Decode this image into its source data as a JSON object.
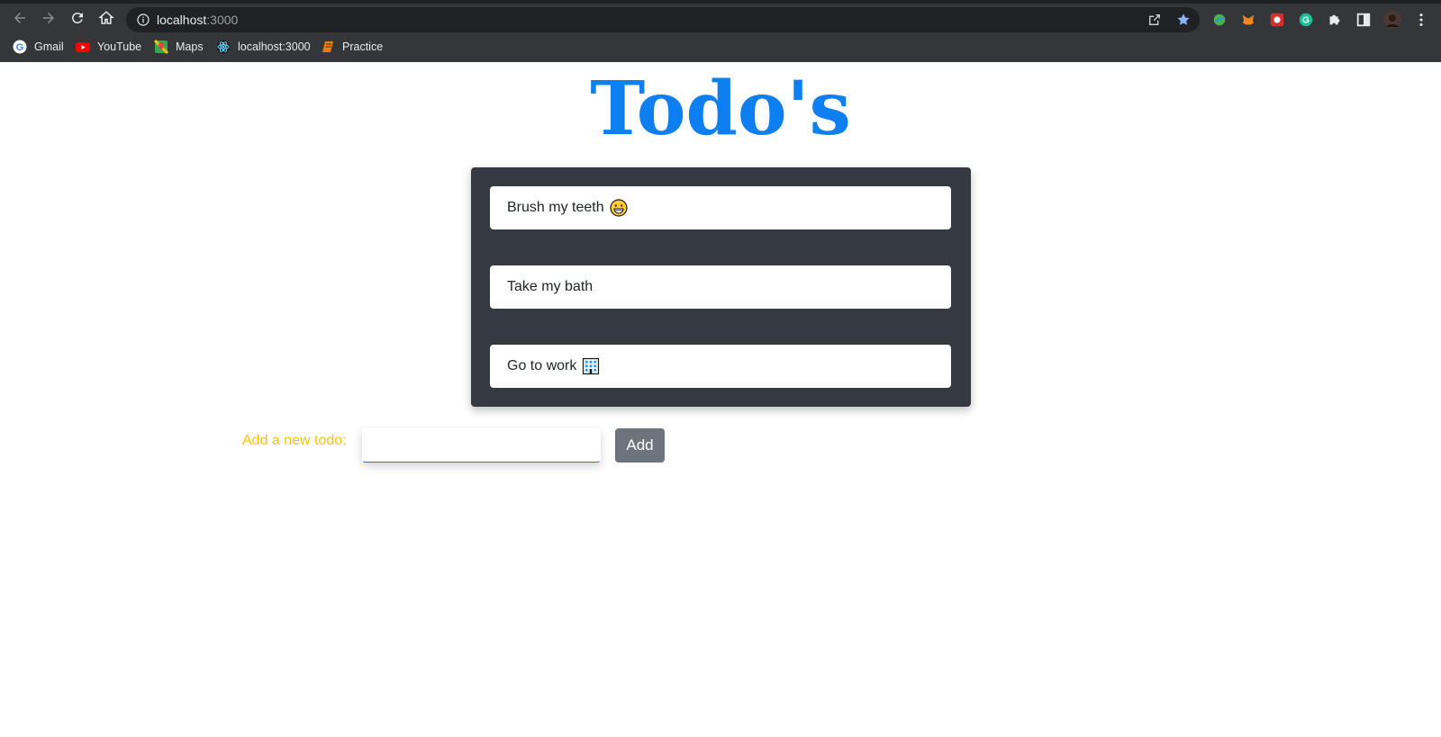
{
  "browser": {
    "url_host": "localhost",
    "url_port": ":3000",
    "bookmarks": [
      {
        "label": "Gmail",
        "icon": "google-icon"
      },
      {
        "label": "YouTube",
        "icon": "youtube-icon"
      },
      {
        "label": "Maps",
        "icon": "maps-icon"
      },
      {
        "label": "localhost:3000",
        "icon": "react-icon"
      },
      {
        "label": "Practice",
        "icon": "bookmark-practice-icon"
      }
    ]
  },
  "app": {
    "title": "Todo's",
    "todos": [
      {
        "text": "Brush my teeth",
        "emoji": "😁"
      },
      {
        "text": "Take my bath",
        "emoji": ""
      },
      {
        "text": "Go to work",
        "emoji": "🏢"
      }
    ],
    "add_label": "Add a new todo:",
    "input_value": "",
    "add_button_label": "Add"
  },
  "colors": {
    "title": "#0d7ff0",
    "todo_box_bg": "#343a40",
    "add_label": "#ffc107",
    "add_button_bg": "#6c757d",
    "chrome_bg": "#35363a"
  }
}
